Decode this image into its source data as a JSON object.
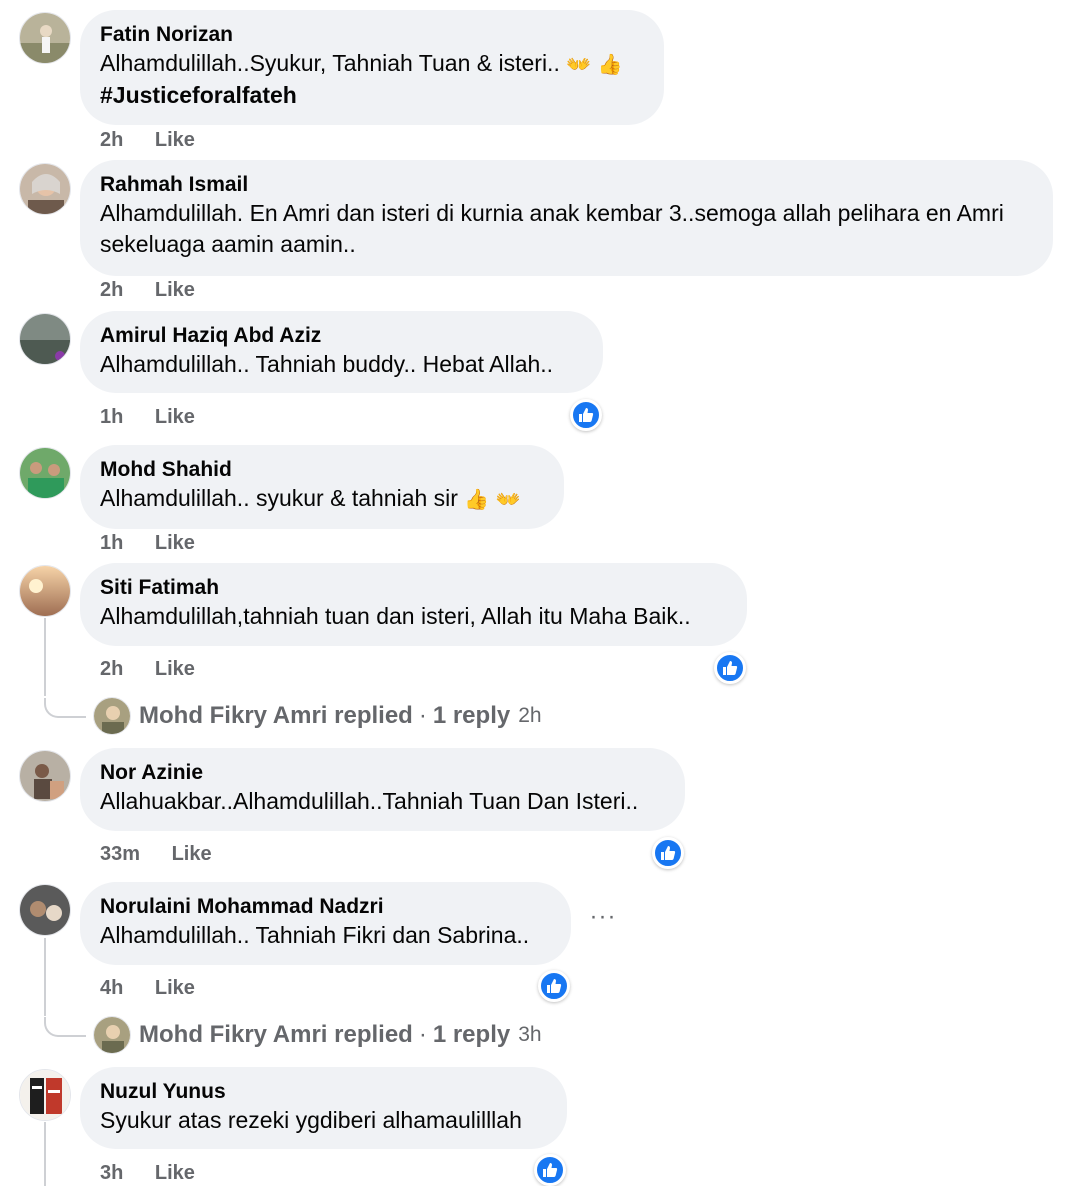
{
  "comments": [
    {
      "author": "Fatin Norizan",
      "text": "Alhamdulillah..Syukur, Tahniah Tuan & isteri..",
      "emoji": "👐 👍",
      "hashtag": "#Justiceforalfateh",
      "time": "2h",
      "like": "Like"
    },
    {
      "author": "Rahmah Ismail",
      "text": "Alhamdulillah. En Amri dan isteri di kurnia anak kembar 3..semoga allah pelihara en Amri sekeluaga aamin aamin..",
      "time": "2h",
      "like": "Like"
    },
    {
      "author": "Amirul Haziq Abd Aziz",
      "text": "Alhamdulillah.. Tahniah buddy.. Hebat Allah..",
      "time": "1h",
      "like": "Like"
    },
    {
      "author": "Mohd Shahid",
      "text": "Alhamdulillah.. syukur & tahniah sir",
      "emoji": "👍 👐",
      "time": "1h",
      "like": "Like"
    },
    {
      "author": "Siti Fatimah",
      "text": "Alhamdulillah,tahniah tuan dan isteri, Allah itu Maha Baik..",
      "time": "2h",
      "like": "Like",
      "reply": {
        "name": "Mohd Fikry Amri replied",
        "count": "1 reply",
        "time": "2h"
      }
    },
    {
      "author": "Nor Azinie",
      "text": "Allahuakbar..Alhamdulillah..Tahniah Tuan Dan Isteri..",
      "time": "33m",
      "like": "Like"
    },
    {
      "author": "Norulaini Mohammad Nadzri",
      "text": "Alhamdulillah.. Tahniah Fikri dan Sabrina..",
      "time": "4h",
      "like": "Like",
      "reply": {
        "name": "Mohd Fikry Amri replied",
        "count": "1 reply",
        "time": "3h"
      }
    },
    {
      "author": "Nuzul Yunus",
      "text": "Syukur atas rezeki ygdiberi alhamaulilllah",
      "time": "3h",
      "like": "Like"
    }
  ],
  "more_options": "···",
  "reply_separator": "·",
  "icons": {
    "like_badge": "thumbs-up-icon",
    "more": "more-options-icon"
  },
  "colors": {
    "bubble": "#f0f2f5",
    "like_blue": "#1877f2",
    "meta_gray": "#65676b"
  }
}
